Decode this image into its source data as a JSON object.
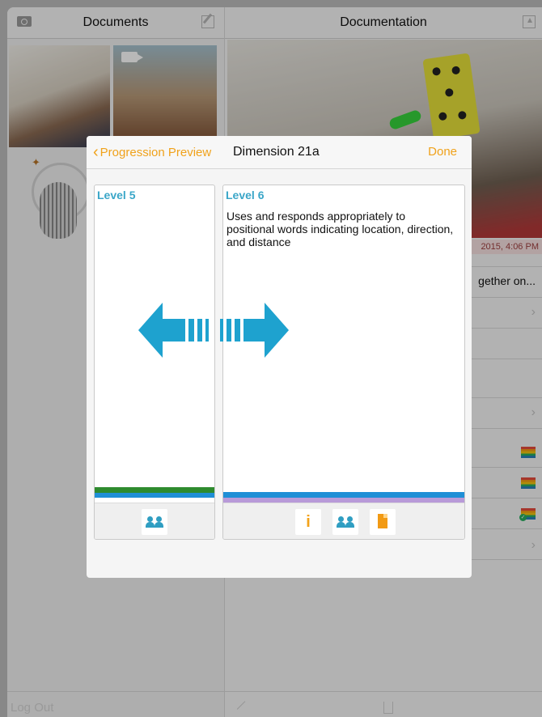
{
  "left_pane": {
    "title": "Documents",
    "logout_label": "Log Out"
  },
  "right_pane": {
    "title": "Documentation",
    "timestamp": "2015, 4:06 PM",
    "row_text": "gether on..."
  },
  "modal": {
    "back_label": "Progression Preview",
    "title": "Dimension 21a",
    "done_label": "Done",
    "cards": [
      {
        "level": "Level 5",
        "description": ""
      },
      {
        "level": "Level 6",
        "description": "Uses and responds appropriately to positional words indicating location, direction, and distance"
      }
    ]
  },
  "colors": {
    "accent_orange": "#f0a21b",
    "level_blue": "#3aa6c8",
    "arrow_blue": "#1ea2cf",
    "stripe_green": "#2e8b2e",
    "stripe_blue": "#1f8fd6",
    "stripe_purple": "#b89ad8"
  },
  "icons": [
    "camera-icon",
    "compose-icon",
    "share-icon",
    "video-icon",
    "butterfly-icon",
    "microphone-icon",
    "expand-icon",
    "trash-icon",
    "chevron-left-icon",
    "people-icon",
    "info-icon",
    "document-icon",
    "double-arrow-icon"
  ]
}
